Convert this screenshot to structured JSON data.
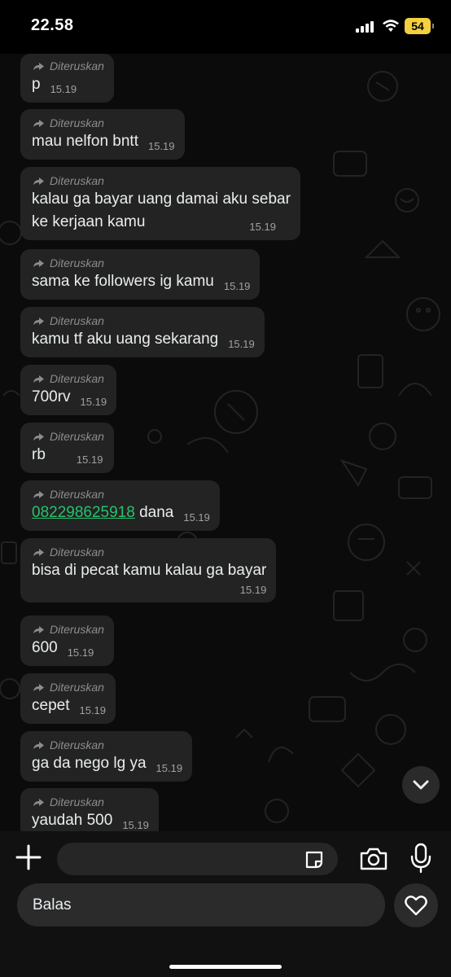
{
  "status_bar": {
    "time": "22.58",
    "battery": "54",
    "icons": [
      "signal-icon",
      "wifi-icon",
      "battery-icon"
    ]
  },
  "forward_label": "Diteruskan",
  "messages": [
    {
      "text": "p",
      "time": "15.19"
    },
    {
      "text": "mau nelfon bntt",
      "time": "15.19"
    },
    {
      "line1": "kalau ga bayar uang damai aku sebar",
      "line2": "ke kerjaan kamu",
      "time": "15.19"
    },
    {
      "text": "sama ke followers ig kamu",
      "time": "15.19"
    },
    {
      "text": "kamu tf aku uang sekarang",
      "time": "15.19"
    },
    {
      "text": "700rv",
      "time": "15.19"
    },
    {
      "text": "rb",
      "time": "15.19"
    },
    {
      "link": "082298625918",
      "text": " dana",
      "time": "15.19"
    },
    {
      "text": "bisa di pecat kamu kalau ga bayar",
      "time": "15.19"
    },
    {
      "text": "600",
      "time": "15.19"
    },
    {
      "text": "cepet",
      "time": "15.19"
    },
    {
      "text": "ga da nego lg ya",
      "time": "15.19"
    },
    {
      "text": "yaudah 500",
      "time": "15.19"
    }
  ],
  "composer": {
    "reply_placeholder": "Balas",
    "icons": [
      "plus-icon",
      "sticker-icon",
      "camera-icon",
      "mic-icon",
      "heart-icon"
    ]
  },
  "colors": {
    "bubble": "#232323",
    "link": "#25c26e",
    "battery": "#f4d03f",
    "background": "#0b0b0b"
  }
}
